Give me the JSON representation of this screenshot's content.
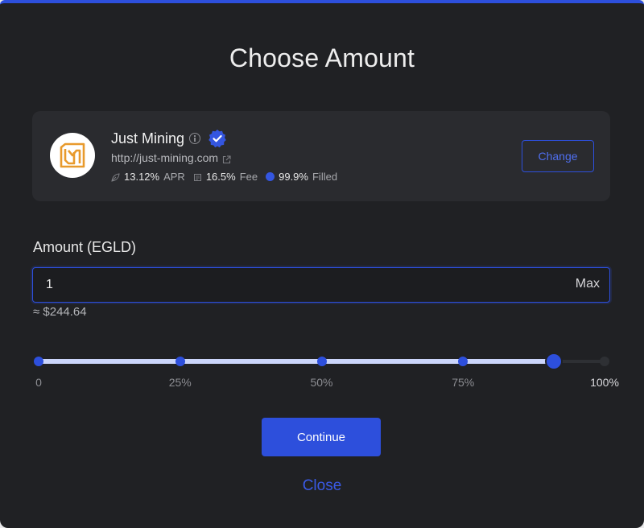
{
  "modal": {
    "title": "Choose Amount",
    "accent": "#2d4fdc"
  },
  "provider": {
    "name": "Just Mining",
    "url": "http://just-mining.com",
    "logo_icon": "just-mining-logo",
    "logo_color": "#e89a2c",
    "stats": {
      "apr_value": "13.12%",
      "apr_label": "APR",
      "fee_value": "16.5%",
      "fee_label": "Fee",
      "filled_value": "99.9%",
      "filled_label": "Filled"
    },
    "change_label": "Change"
  },
  "amount": {
    "label": "Amount (EGLD)",
    "value": "1",
    "max_label": "Max",
    "usd_approx": "≈ $244.64"
  },
  "slider": {
    "ticks": [
      "0",
      "25%",
      "50%",
      "75%",
      "100%"
    ],
    "value_fraction": 0.91
  },
  "actions": {
    "continue_label": "Continue",
    "close_label": "Close"
  }
}
